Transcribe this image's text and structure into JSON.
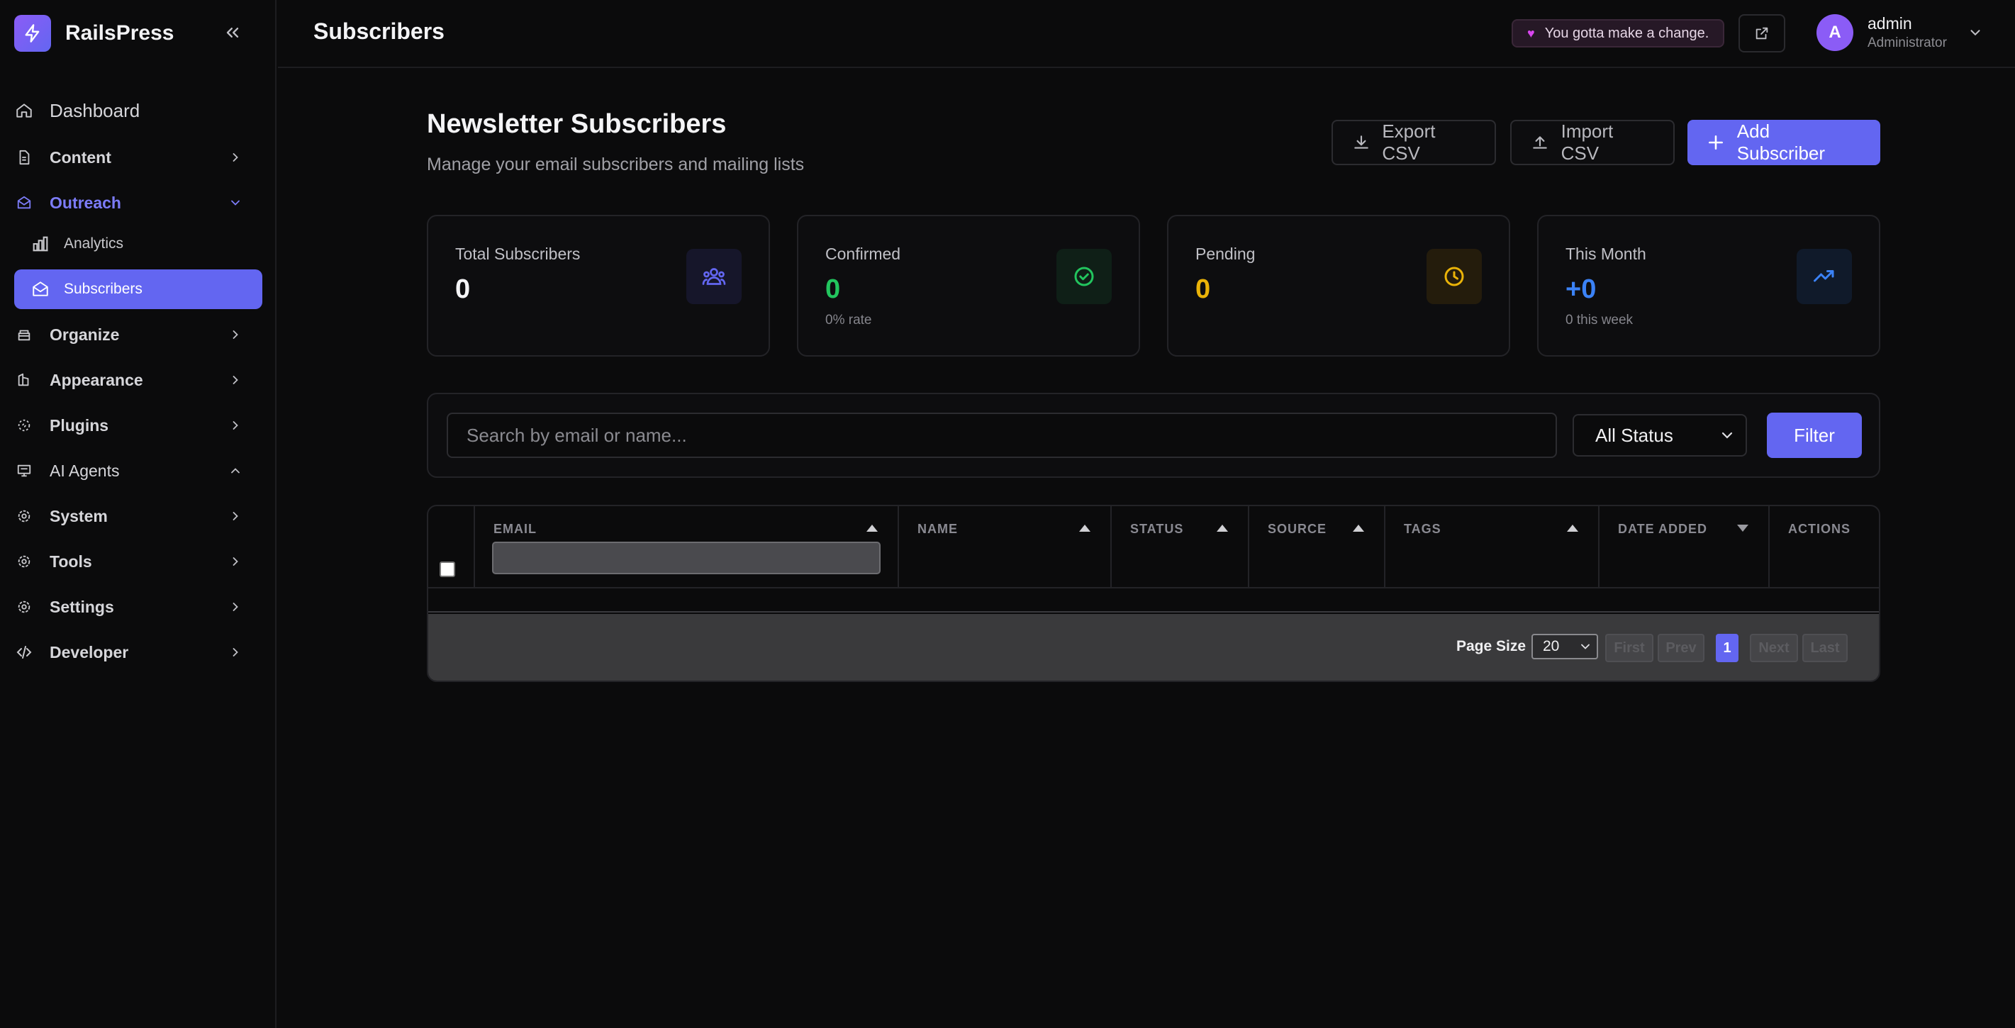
{
  "app": {
    "name": "RailsPress"
  },
  "sidebar": {
    "dashboard": "Dashboard",
    "content": "Content",
    "outreach": "Outreach",
    "analytics": "Analytics",
    "subscribers": "Subscribers",
    "organize": "Organize",
    "appearance": "Appearance",
    "plugins": "Plugins",
    "ai_agents": "AI Agents",
    "system": "System",
    "tools": "Tools",
    "settings": "Settings",
    "developer": "Developer"
  },
  "header": {
    "title": "Subscribers",
    "motto": "You gotta make a change.",
    "user": {
      "initial": "A",
      "name": "admin",
      "role": "Administrator"
    }
  },
  "main": {
    "title": "Newsletter Subscribers",
    "subtitle": "Manage your email subscribers and mailing lists",
    "buttons": {
      "export": "Export CSV",
      "import": "Import CSV",
      "add": "Add Subscriber"
    }
  },
  "stats": [
    {
      "label": "Total Subscribers",
      "value": "0",
      "note": "",
      "color": "#f4f4f6",
      "icon": "users-icon"
    },
    {
      "label": "Confirmed",
      "value": "0",
      "note": "0% rate",
      "color": "#22c55e",
      "icon": "check-circle-icon"
    },
    {
      "label": "Pending",
      "value": "0",
      "note": "",
      "color": "#eab308",
      "icon": "clock-icon"
    },
    {
      "label": "This Month",
      "value": "+0",
      "note": "0 this week",
      "color": "#3b82f6",
      "icon": "trending-up-icon"
    }
  ],
  "filters": {
    "search_placeholder": "Search by email or name...",
    "status": "All Status",
    "filter_button": "Filter"
  },
  "table": {
    "columns": [
      "EMAIL",
      "NAME",
      "STATUS",
      "SOURCE",
      "TAGS",
      "DATE ADDED",
      "ACTIONS"
    ],
    "rows": []
  },
  "pagination": {
    "page_size_label": "Page Size",
    "page_size": "20",
    "first": "First",
    "prev": "Prev",
    "current": "1",
    "next": "Next",
    "last": "Last"
  },
  "colors": {
    "accent": "#6366f1",
    "brand": "#8b5cf6"
  }
}
